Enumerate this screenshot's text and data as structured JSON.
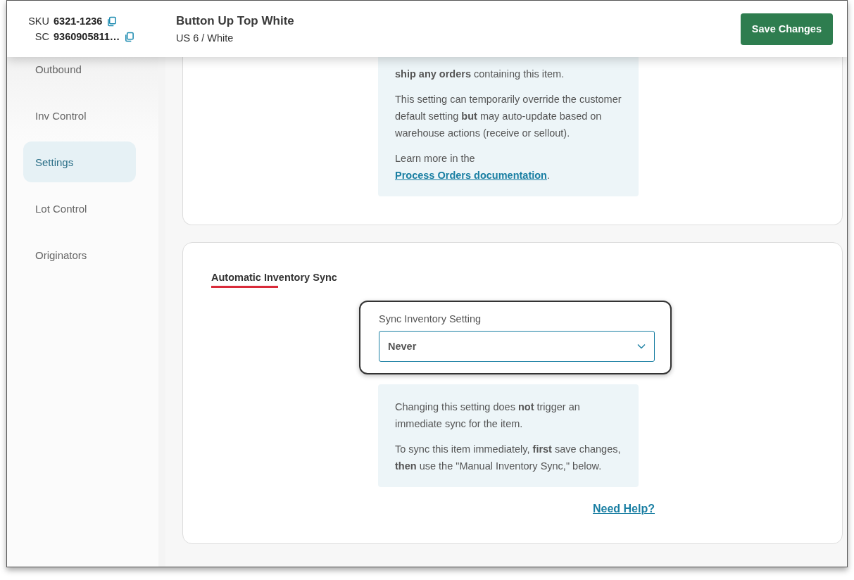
{
  "header": {
    "identifiers": [
      {
        "label": "SKU",
        "value": "6321-1236"
      },
      {
        "label": "SC",
        "value": "9360905811…"
      }
    ],
    "title": "Button Up Top White",
    "subtitle": "US 6 / White",
    "save_button": "Save Changes"
  },
  "sidebar": {
    "items": [
      {
        "label": "Outbound",
        "selected": false
      },
      {
        "label": "Inv Control",
        "selected": false
      },
      {
        "label": "Settings",
        "selected": true
      },
      {
        "label": "Lot Control",
        "selected": false
      },
      {
        "label": "Originators",
        "selected": false
      }
    ]
  },
  "process_orders_card": {
    "info": [
      {
        "text": "**ship any orders** containing this item."
      },
      {
        "text": "This setting can temporarily override the customer default setting **but** may auto-update based on warehouse actions (receive or sellout)."
      },
      {
        "text": "Learn more in the ",
        "link": "Process Orders documentation",
        "after": "."
      }
    ]
  },
  "inventory_sync_card": {
    "title": "Automatic Inventory Sync",
    "field": {
      "label": "Sync Inventory Setting",
      "value": "Never"
    },
    "info": [
      {
        "text": "Changing this setting does **not** trigger an immediate sync for the item."
      },
      {
        "text": "To sync this item immediately, **first** save changes, **then** use the \"Manual Inventory Sync,\" below."
      }
    ],
    "help_link": "Need Help?"
  }
}
